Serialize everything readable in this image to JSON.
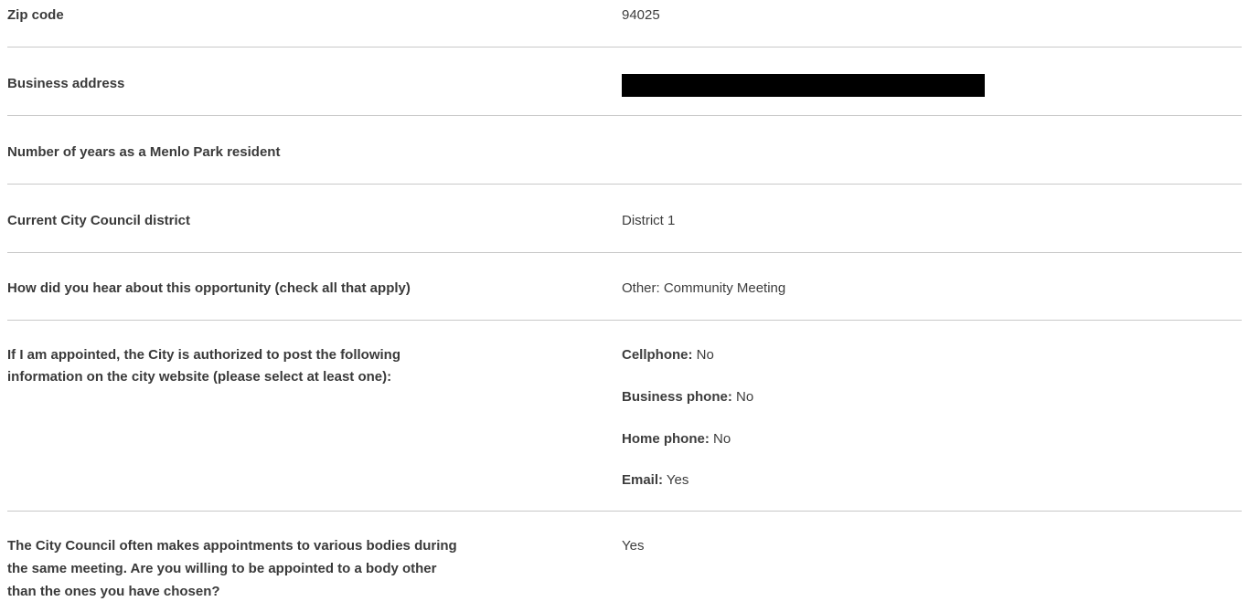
{
  "rows": {
    "zip": {
      "label": "Zip code",
      "value": "94025"
    },
    "business_address": {
      "label": "Business address",
      "value": ""
    },
    "years_resident": {
      "label": "Number of years as a Menlo Park resident",
      "value": ""
    },
    "district": {
      "label": "Current City Council district",
      "value": "District 1"
    },
    "heard_about": {
      "label": "How did you hear about this opportunity (check all that apply)",
      "value": "Other: Community Meeting"
    },
    "authorize_post": {
      "label_line1": "If I am appointed, the City is authorized to post the following",
      "label_line2": "information on the city website (please select at least one):",
      "items": [
        {
          "label": "Cellphone:",
          "value": "No"
        },
        {
          "label": "Business phone:",
          "value": "No"
        },
        {
          "label": "Home phone:",
          "value": "No"
        },
        {
          "label": "Email:",
          "value": "Yes"
        }
      ]
    },
    "other_body": {
      "label_line1": "The City Council often makes appointments to various bodies during",
      "label_line2": "the same meeting. Are you willing to be appointed to a body other",
      "label_line3": "than the ones you have chosen?",
      "value": "Yes"
    }
  },
  "colors": {
    "divider": "#c8c8c8",
    "text": "#3d3d3d",
    "redaction": "#000000"
  }
}
